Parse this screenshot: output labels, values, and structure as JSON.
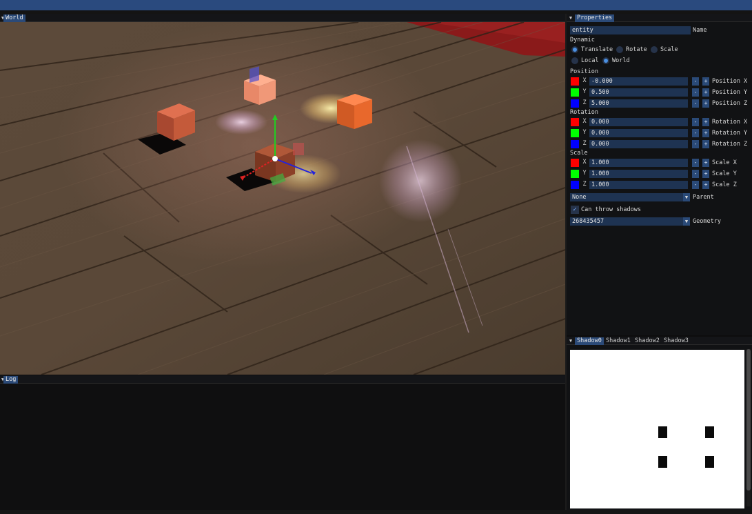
{
  "world": {
    "tab": "World"
  },
  "log": {
    "tab": "Log"
  },
  "properties": {
    "tab": "Properties",
    "name_value": "entity",
    "name_label": "Name",
    "dynamic_label": "Dynamic",
    "gizmo_modes": [
      {
        "label": "Translate",
        "selected": true
      },
      {
        "label": "Rotate",
        "selected": false
      },
      {
        "label": "Scale",
        "selected": false
      }
    ],
    "spaces": [
      {
        "label": "Local",
        "selected": false
      },
      {
        "label": "World",
        "selected": true
      }
    ],
    "groups": [
      {
        "title": "Position",
        "rows": [
          {
            "axis": "X",
            "color": "#ff0000",
            "value": "-0.000",
            "label": "Position X"
          },
          {
            "axis": "Y",
            "color": "#00ff00",
            "value": "0.500",
            "label": "Position Y"
          },
          {
            "axis": "Z",
            "color": "#0000ff",
            "value": "5.000",
            "label": "Position Z"
          }
        ]
      },
      {
        "title": "Rotation",
        "rows": [
          {
            "axis": "X",
            "color": "#ff0000",
            "value": "0.000",
            "label": "Rotation X"
          },
          {
            "axis": "Y",
            "color": "#00ff00",
            "value": "0.000",
            "label": "Rotation Y"
          },
          {
            "axis": "Z",
            "color": "#0000ff",
            "value": "0.000",
            "label": "Rotation Z"
          }
        ]
      },
      {
        "title": "Scale",
        "rows": [
          {
            "axis": "X",
            "color": "#ff0000",
            "value": "1.000",
            "label": "Scale X"
          },
          {
            "axis": "Y",
            "color": "#00ff00",
            "value": "1.000",
            "label": "Scale Y"
          },
          {
            "axis": "Z",
            "color": "#0000ff",
            "value": "1.000",
            "label": "Scale Z"
          }
        ]
      }
    ],
    "minus": "-",
    "plus": "+",
    "parent_value": "None",
    "parent_label": "Parent",
    "shadows_checked": true,
    "shadows_label": "Can throw shadows",
    "geometry_value": "268435457",
    "geometry_label": "Geometry"
  },
  "shadow_tabs": [
    {
      "label": "Shadow0",
      "active": true
    },
    {
      "label": "Shadow1",
      "active": false
    },
    {
      "label": "Shadow2",
      "active": false
    },
    {
      "label": "Shadow3",
      "active": false
    }
  ],
  "icons": {
    "collapse": "triangle-down-icon",
    "combo": "chevron-down-icon",
    "check": "checkmark-icon"
  },
  "colors": {
    "accent": "#2b4a78",
    "field": "#1e3352",
    "topbar": "#2a4a7e"
  }
}
